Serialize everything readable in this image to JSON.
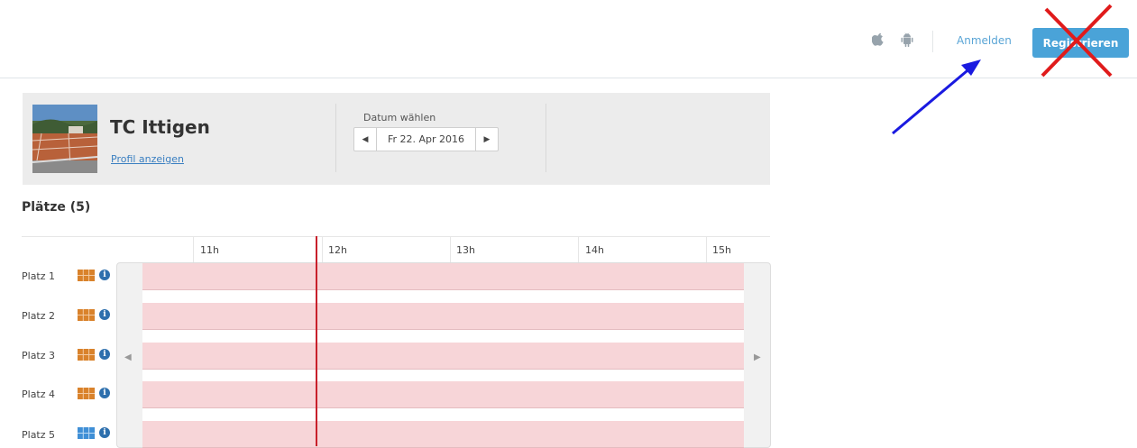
{
  "header": {
    "login_label": "Anmelden",
    "register_label": "Registrieren",
    "icons": [
      "apple-icon",
      "android-icon"
    ]
  },
  "club": {
    "name": "TC Ittigen",
    "profile_link": "Profil anzeigen"
  },
  "date_selector": {
    "label": "Datum wählen",
    "value": "Fr 22. Apr 2016"
  },
  "courts_title": "Plätze (5)",
  "timeline": {
    "hours": [
      "11h",
      "12h",
      "13h",
      "14h",
      "15h"
    ]
  },
  "courts": [
    {
      "label": "Platz 1",
      "surface": "clay"
    },
    {
      "label": "Platz 2",
      "surface": "clay"
    },
    {
      "label": "Platz 3",
      "surface": "clay"
    },
    {
      "label": "Platz 4",
      "surface": "clay"
    },
    {
      "label": "Platz 5",
      "surface": "hard"
    }
  ],
  "colors": {
    "accent": "#4aa3d8",
    "slot_reserved": "#f7d5d8",
    "now_line": "#c8202b",
    "annotation_arrow": "#1a1ae0",
    "annotation_cross": "#e01b1b"
  }
}
